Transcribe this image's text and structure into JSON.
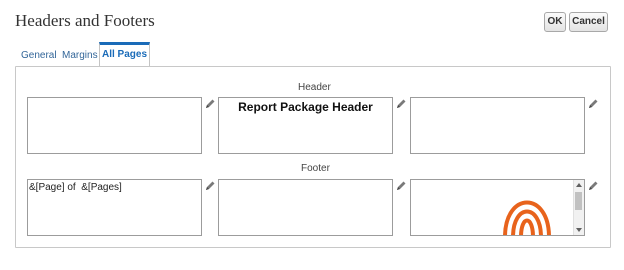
{
  "dialog": {
    "title": "Headers and Footers",
    "ok_label": "OK",
    "cancel_label": "Cancel"
  },
  "tabs": [
    {
      "label": "General",
      "selected": false
    },
    {
      "label": "Margins",
      "selected": false
    },
    {
      "label": "All Pages",
      "selected": true
    }
  ],
  "header": {
    "label": "Header",
    "left": "",
    "center": "Report Package Header",
    "right": ""
  },
  "footer": {
    "label": "Footer",
    "left": "&[Page] of  &[Pages]",
    "center": "",
    "right": ""
  },
  "icons": {
    "edit": "pencil-icon",
    "logo": "orange-arches-logo"
  },
  "colors": {
    "accent": "#1a6bb8",
    "link": "#336699",
    "logo": "#e8631c"
  }
}
